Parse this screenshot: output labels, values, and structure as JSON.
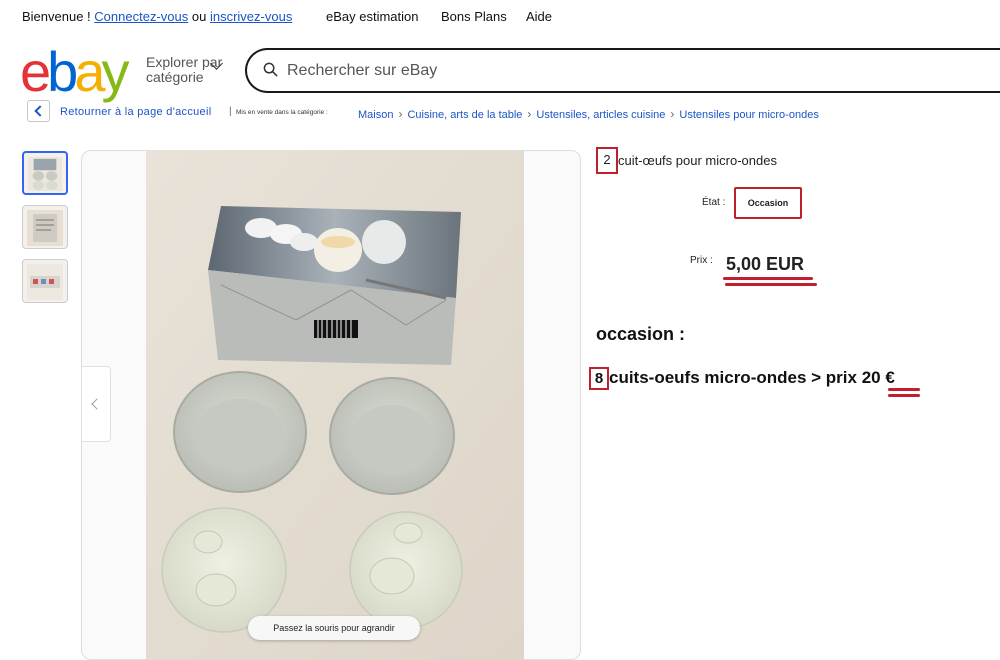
{
  "topnav": {
    "welcome": "Bienvenue !",
    "signin": "Connectez-vous",
    "or": "ou",
    "register": "inscrivez-vous",
    "links": [
      "eBay estimation",
      "Bons Plans",
      "Aide"
    ]
  },
  "header": {
    "logo_letters": [
      "e",
      "b",
      "a",
      "y"
    ],
    "shop_by_category_line1": "Explorer par",
    "shop_by_category_line2": "catégorie",
    "search_placeholder": "Rechercher sur eBay"
  },
  "breadcrumb": {
    "back_label": "Retourner à la page d'accueil",
    "separator": "|",
    "prefix": "Mis en vente dans la catégorie :",
    "items": [
      "Maison",
      "Cuisine, arts de la table",
      "Ustensiles, articles cuisine",
      "Ustensiles pour micro-ondes"
    ]
  },
  "gallery": {
    "thumbnail_count": 3,
    "active_index": 0,
    "zoom_hint": "Passez la souris pour agrandir"
  },
  "listing": {
    "title_qty": "2",
    "title_text": "cuit-œufs pour micro-ondes",
    "condition_label": "État :",
    "condition_value": "Occasion",
    "price_label": "Prix :",
    "price_value": "5,00 EUR"
  },
  "annotation": {
    "heading": "occasion :",
    "qty": "8",
    "text": "cuits-oeufs micro-ondes > prix",
    "amount": "20 €"
  },
  "colors": {
    "link_blue": "#1a55c7",
    "annotation_red": "#c0202e",
    "ebay_red": "#e53238",
    "ebay_blue": "#0064d2",
    "ebay_yellow": "#f5af02",
    "ebay_green": "#86b817"
  }
}
